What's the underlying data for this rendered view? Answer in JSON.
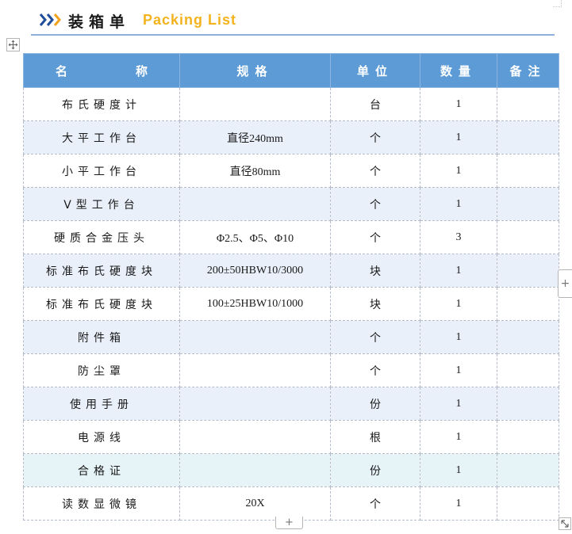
{
  "header": {
    "title_cn": "装箱单",
    "title_en": "Packing List",
    "title_en_color": "#f3b31e",
    "chevron_colors": [
      "#1f4e9c",
      "#1f4e9c",
      "#f3a21e"
    ]
  },
  "table": {
    "headers": {
      "name_left": "名",
      "name_right": "称",
      "spec": "规格",
      "unit": "单位",
      "qty": "数量",
      "note": "备注"
    },
    "header_color": "#5c9bd5",
    "rows": [
      {
        "name": "布氏硬度计",
        "spec": "",
        "unit": "台",
        "qty": "1",
        "note": ""
      },
      {
        "name": "大平工作台",
        "spec": "直径240mm",
        "unit": "个",
        "qty": "1",
        "note": ""
      },
      {
        "name": "小平工作台",
        "spec": "直径80mm",
        "unit": "个",
        "qty": "1",
        "note": ""
      },
      {
        "name": "V型工作台",
        "spec": "",
        "unit": "个",
        "qty": "1",
        "note": ""
      },
      {
        "name": "硬质合金压头",
        "spec": "Φ2.5、Φ5、Φ10",
        "unit": "个",
        "qty": "3",
        "note": ""
      },
      {
        "name": "标准布氏硬度块",
        "spec": "200±50HBW10/3000",
        "unit": "块",
        "qty": "1",
        "note": ""
      },
      {
        "name": "标准布氏硬度块",
        "spec": "100±25HBW10/1000",
        "unit": "块",
        "qty": "1",
        "note": ""
      },
      {
        "name": "附件箱",
        "spec": "",
        "unit": "个",
        "qty": "1",
        "note": ""
      },
      {
        "name": "防尘罩",
        "spec": "",
        "unit": "个",
        "qty": "1",
        "note": ""
      },
      {
        "name": "使用手册",
        "spec": "",
        "unit": "份",
        "qty": "1",
        "note": ""
      },
      {
        "name": "电源线",
        "spec": "",
        "unit": "根",
        "qty": "1",
        "note": ""
      },
      {
        "name": "合格证",
        "spec": "",
        "unit": "份",
        "qty": "1",
        "note": ""
      },
      {
        "name": "读数显微镜",
        "spec": "20X",
        "unit": "个",
        "qty": "1",
        "note": ""
      }
    ]
  },
  "controls": {
    "add_column_label": "+",
    "add_row_label": "+",
    "move_icon": "move-arrows-icon",
    "resize_icon": "resize-diagonal-icon"
  }
}
